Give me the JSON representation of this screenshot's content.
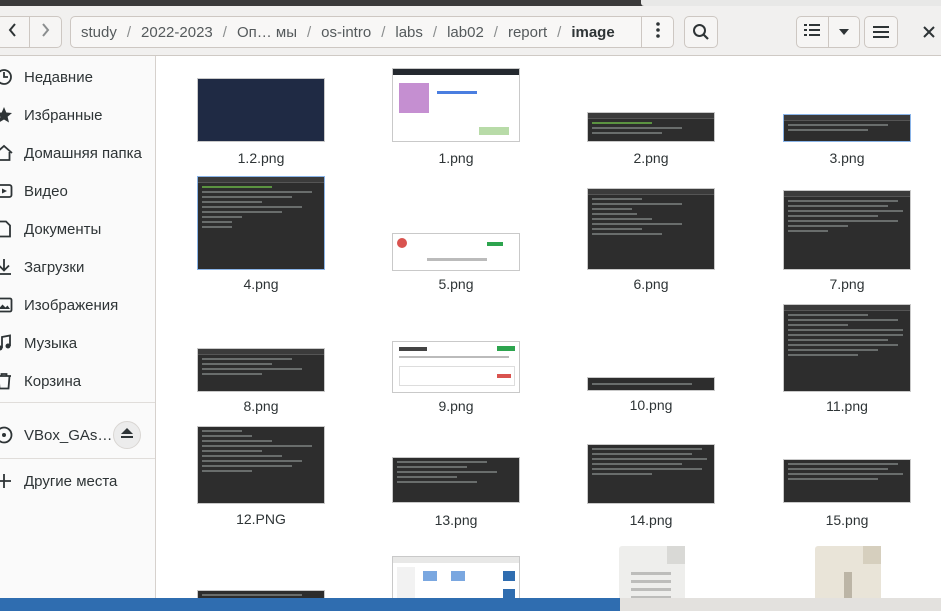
{
  "window": {
    "breadcrumbs": [
      "study",
      "2022-2023",
      "Оп… мы",
      "os-intro",
      "labs",
      "lab02",
      "report",
      "image"
    ],
    "breadcrumb_separator": "/",
    "icons": {
      "back": "chevron-left-icon",
      "forward": "chevron-right-icon",
      "path_menu": "vertical-dots-icon",
      "search": "search-icon",
      "view_list": "list-view-icon",
      "view_dropdown": "chevron-down-icon",
      "main_menu": "hamburger-icon",
      "close": "close-icon"
    }
  },
  "sidebar": {
    "items": [
      {
        "label": "Недавние",
        "icon": "clock-icon"
      },
      {
        "label": "Избранные",
        "icon": "star-icon"
      },
      {
        "label": "Домашняя папка",
        "icon": "home-icon"
      },
      {
        "label": "Видео",
        "icon": "video-icon"
      },
      {
        "label": "Документы",
        "icon": "document-icon"
      },
      {
        "label": "Загрузки",
        "icon": "download-icon"
      },
      {
        "label": "Изображения",
        "icon": "image-icon"
      },
      {
        "label": "Музыка",
        "icon": "music-icon"
      },
      {
        "label": "Корзина",
        "icon": "trash-icon"
      }
    ],
    "devices": [
      {
        "label": "VBox_GAs…",
        "icon": "disc-icon"
      }
    ],
    "other": {
      "label": "Другие места",
      "icon": "plus-icon"
    }
  },
  "files": [
    {
      "name": "1.2.png",
      "kind": "dark-blue"
    },
    {
      "name": "1.png",
      "kind": "web"
    },
    {
      "name": "2.png",
      "kind": "term"
    },
    {
      "name": "3.png",
      "kind": "term"
    },
    {
      "name": "4.png",
      "kind": "term"
    },
    {
      "name": "5.png",
      "kind": "web"
    },
    {
      "name": "6.png",
      "kind": "term"
    },
    {
      "name": "7.png",
      "kind": "term"
    },
    {
      "name": "8.png",
      "kind": "term"
    },
    {
      "name": "9.png",
      "kind": "web"
    },
    {
      "name": "10.png",
      "kind": "term"
    },
    {
      "name": "11.png",
      "kind": "term"
    },
    {
      "name": "12.PNG",
      "kind": "term"
    },
    {
      "name": "13.png",
      "kind": "term"
    },
    {
      "name": "14.png",
      "kind": "term"
    },
    {
      "name": "15.png",
      "kind": "term"
    }
  ],
  "colors": {
    "accent": "#2f6db0",
    "terminal_bg": "#2d2d2d",
    "text": "#2e3436"
  }
}
